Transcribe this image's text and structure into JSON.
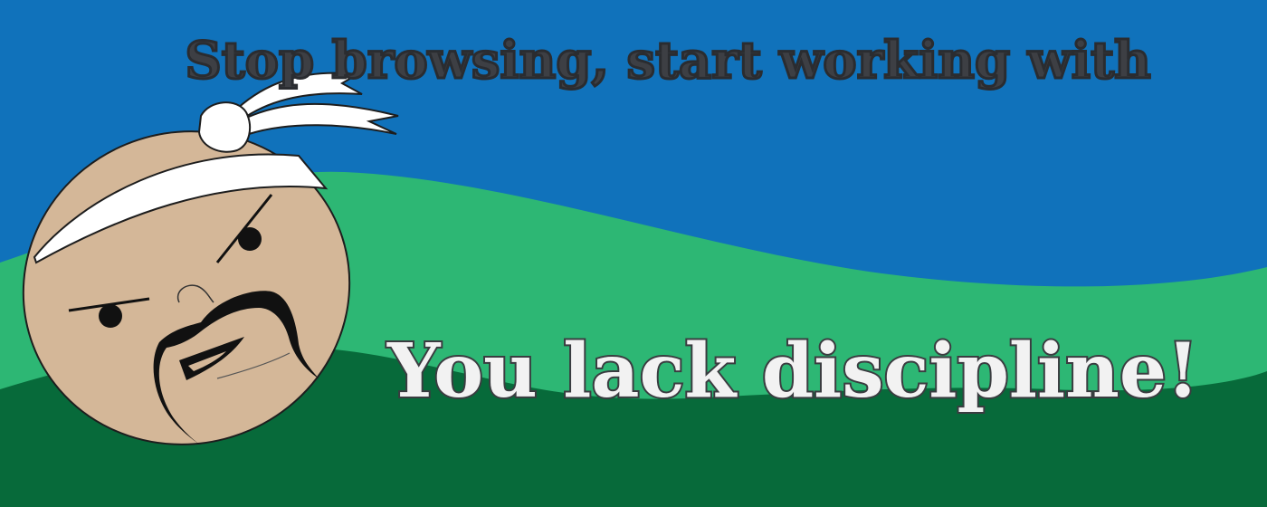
{
  "banner": {
    "headline": "Stop browsing, start working with",
    "tagline": "You lack discipline!"
  },
  "colors": {
    "sky": "#1072bb",
    "hill_light": "#2db774",
    "hill_dark": "#076a3a",
    "face": "#d4b798",
    "headband": "#ffffff",
    "headline_text": "#3d3f44",
    "tagline_text": "#f2f2f2"
  },
  "icons": {
    "mascot": "angry-master-face-icon"
  }
}
